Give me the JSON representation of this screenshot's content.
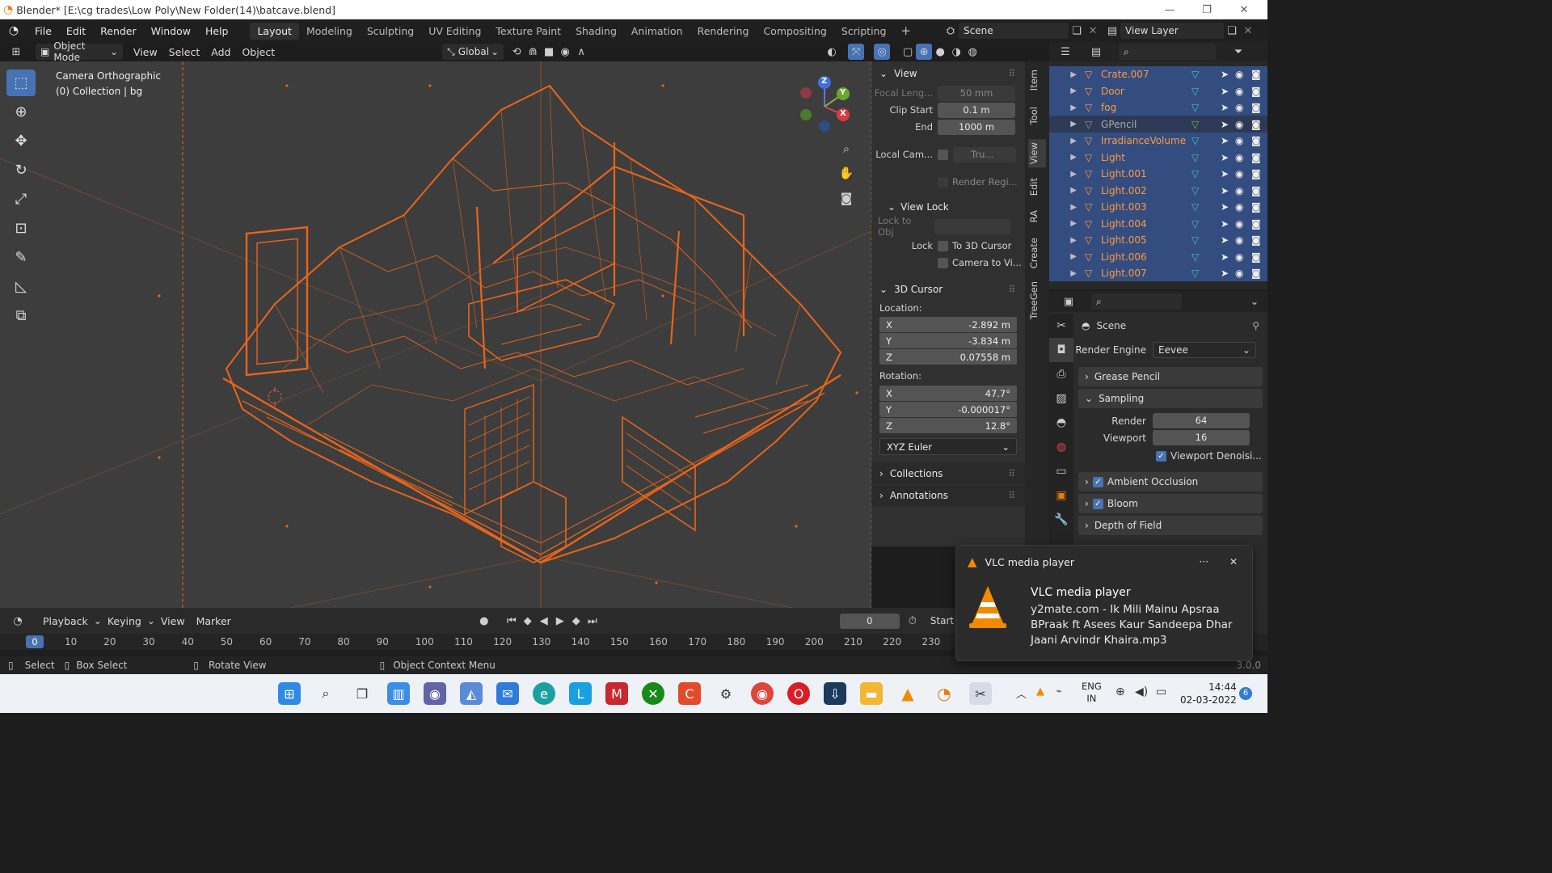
{
  "window": {
    "title": "Blender* [E:\\cg trades\\Low Poly\\New Folder(14)\\batcave.blend]"
  },
  "menu": [
    "File",
    "Edit",
    "Render",
    "Window",
    "Help"
  ],
  "workspaces": [
    "Layout",
    "Modeling",
    "Sculpting",
    "UV Editing",
    "Texture Paint",
    "Shading",
    "Animation",
    "Rendering",
    "Compositing",
    "Scripting"
  ],
  "active_workspace": "Layout",
  "scene": {
    "name": "Scene",
    "view_layer": "View Layer"
  },
  "viewport_header": {
    "mode": "Object Mode",
    "items": [
      "View",
      "Select",
      "Add",
      "Object"
    ],
    "orientation": "Global"
  },
  "viewport": {
    "camera_label": "Camera Orthographic",
    "collection_label": "(0) Collection | bg"
  },
  "gizmo": {
    "z": "Z",
    "y": "Y",
    "x": "X"
  },
  "npanel": {
    "view_title": "View",
    "focal_label": "Focal Leng...",
    "focal_value": "50 mm",
    "clip_start_label": "Clip Start",
    "clip_start_value": "0.1 m",
    "clip_end_label": "End",
    "clip_end_value": "1000 m",
    "local_cam_label": "Local Cam...",
    "local_cam_value": "Tru...",
    "render_region_label": "Render Regi...",
    "view_lock_title": "View Lock",
    "lock_to_obj_label": "Lock to Obj",
    "lock_label": "Lock",
    "to_3d_cursor": "To 3D Cursor",
    "camera_to_view": "Camera to Vi...",
    "cursor_title": "3D Cursor",
    "location_label": "Location:",
    "loc": [
      {
        "axis": "X",
        "value": "-2.892 m"
      },
      {
        "axis": "Y",
        "value": "-3.834 m"
      },
      {
        "axis": "Z",
        "value": "0.07558 m"
      }
    ],
    "rotation_label": "Rotation:",
    "rot": [
      {
        "axis": "X",
        "value": "47.7°"
      },
      {
        "axis": "Y",
        "value": "-0.000017°"
      },
      {
        "axis": "Z",
        "value": "12.8°"
      }
    ],
    "rotation_mode": "XYZ Euler",
    "collections_title": "Collections",
    "annotations_title": "Annotations"
  },
  "side_tabs": [
    "Item",
    "Tool",
    "View",
    "Edit",
    "RA",
    "Create",
    "TreeGen"
  ],
  "outliner": {
    "rows": [
      {
        "name": "Crate.007",
        "dim": false
      },
      {
        "name": "Door",
        "dim": false
      },
      {
        "name": "fog",
        "dim": false
      },
      {
        "name": "GPencil",
        "dim": true
      },
      {
        "name": "IrradianceVolume",
        "dim": false
      },
      {
        "name": "Light",
        "dim": false
      },
      {
        "name": "Light.001",
        "dim": false
      },
      {
        "name": "Light.002",
        "dim": false
      },
      {
        "name": "Light.003",
        "dim": false
      },
      {
        "name": "Light.004",
        "dim": false
      },
      {
        "name": "Light.005",
        "dim": false
      },
      {
        "name": "Light.006",
        "dim": false
      },
      {
        "name": "Light.007",
        "dim": false
      }
    ]
  },
  "properties": {
    "scene_label": "Scene",
    "render_engine_label": "Render Engine",
    "render_engine_value": "Eevee",
    "grease_pencil": "Grease Pencil",
    "sampling": "Sampling",
    "render_label": "Render",
    "render_value": "64",
    "viewport_label": "Viewport",
    "viewport_value": "16",
    "viewport_denoise": "Viewport Denoisi...",
    "ambient_occlusion": "Ambient Occlusion",
    "bloom": "Bloom",
    "depth_of_field": "Depth of Field"
  },
  "timeline": {
    "menus": [
      "Playback",
      "Keying",
      "View",
      "Marker"
    ],
    "current_frame": "0",
    "start_label": "Start",
    "frame_marker": "0",
    "ticks": [
      "10",
      "20",
      "30",
      "40",
      "50",
      "60",
      "70",
      "80",
      "90",
      "100",
      "110",
      "120",
      "130",
      "140",
      "150",
      "160",
      "170",
      "180",
      "190",
      "200",
      "210",
      "220",
      "230"
    ]
  },
  "status": {
    "select": "Select",
    "box_select": "Box Select",
    "rotate_view": "Rotate View",
    "context_menu": "Object Context Menu",
    "version": "3.0.0"
  },
  "vlc": {
    "header": "VLC media player",
    "title": "VLC media player",
    "line1": "y2mate.com - Ik Mili Mainu Apsraa",
    "line2": "BPraak ft Asees Kaur Sandeepa Dhar",
    "line3": "Jaani  Arvindr Khaira.mp3",
    "more": "···",
    "close": "✕"
  },
  "tray": {
    "lang1": "ENG",
    "lang2": "IN",
    "time": "14:44",
    "date": "02-03-2022",
    "badge": "6"
  },
  "colors": {
    "wire": "#e8641a",
    "selection": "#4772b3",
    "outliner_row": "#334d80",
    "object_text": "#ff9a3c"
  }
}
